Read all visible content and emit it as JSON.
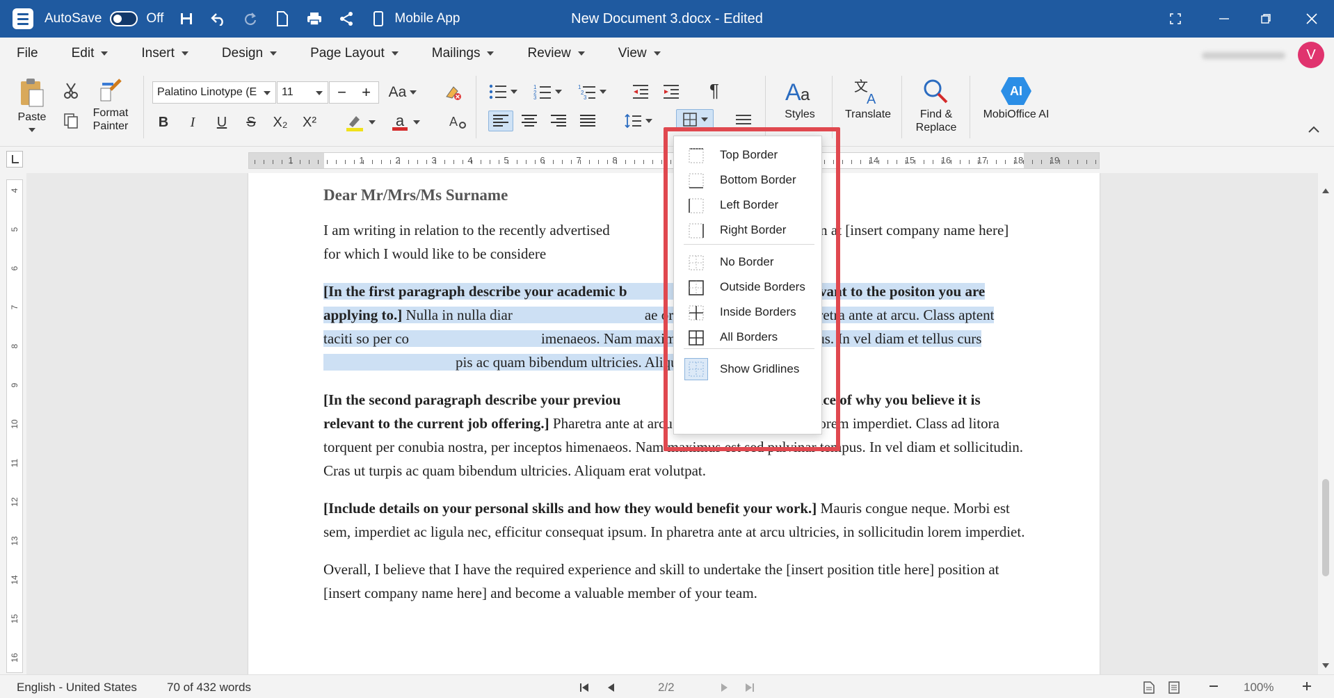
{
  "titlebar": {
    "autosave_label": "AutoSave",
    "autosave_state": "Off",
    "mobile_app_label": "Mobile App",
    "document_title": "New Document 3.docx - Edited"
  },
  "menubar": {
    "items": [
      "File",
      "Edit",
      "Insert",
      "Design",
      "Page Layout",
      "Mailings",
      "Review",
      "View"
    ],
    "avatar_initial": "V"
  },
  "ribbon": {
    "paste_label": "Paste",
    "format_painter_line1": "Format",
    "format_painter_line2": "Painter",
    "font_name": "Palatino Linotype (E",
    "font_size": "11",
    "case_label": "Aa",
    "styles_label": "Styles",
    "translate_label": "Translate",
    "find_replace_line1": "Find &",
    "find_replace_line2": "Replace",
    "mobioffice_ai_label": "MobiOffice AI",
    "ai_badge": "AI",
    "bold": "B",
    "italic": "I",
    "underline": "U",
    "strike": "S",
    "subscript": "X₂",
    "superscript": "X²",
    "font_color_glyph": "a",
    "pilcrow": "¶"
  },
  "ruler": {
    "h_numbers": [
      "1",
      "1",
      "2",
      "3",
      "4",
      "5",
      "6",
      "7",
      "8",
      "14",
      "15",
      "16",
      "17",
      "18",
      "19"
    ],
    "v_numbers": [
      "4",
      "5",
      "6",
      "7",
      "8",
      "9",
      "10",
      "11",
      "12",
      "13",
      "14",
      "15",
      "16"
    ]
  },
  "document": {
    "greeting": "Dear Mr/Mrs/Ms Surname",
    "p1_a": "I am writing in relation to the recently advertised ",
    "p1_b": "position at [insert company name here] for which I would like to be considere",
    "p2_bold": "[In the first paragraph describe your academic b",
    "p2_bold_b": "y it is relevant to the positon you are applying to.]",
    "p2_rest": " Nulla in nulla diar",
    "p2_rest_b": "ae orci auctor placerat. In pharetra ante at arcu. Class aptent taciti so per co",
    "p2_rest_c": "imenaeos. Nam maximus est sed pulvinar tempus. In vel diam et tellus curs",
    "p2_rest_d": "pis ac quam bibendum ultricies. Aliquam erat volutpat.]",
    "p3_bold": "[In the second paragraph describe your previou",
    "p3_bold_b": "vide evidence of why you believe it is relevant to the current job offering.]",
    "p3_rest": " Pharetra ante at arcu ultricies, in sollicitudin lorem imperdiet. Class ad litora torquent per conubia nostra, per inceptos himenaeos. Nam maximus est sed pulvinar tempus. In vel diam et sollicitudin. Cras ut turpis ac quam bibendum ultricies. Aliquam erat volutpat.",
    "p4_bold": "[Include details on your personal skills and how they would benefit your work.]",
    "p4_rest": " Mauris congue neque. Morbi est sem, imperdiet ac ligula nec, efficitur consequat ipsum. In pharetra ante at arcu ultricies, in sollicitudin lorem imperdiet.",
    "p5": "Overall, I believe that I have the required experience and skill to undertake the [insert position title here] position at [insert company name here] and become a valuable member of your team."
  },
  "border_menu": {
    "items": [
      {
        "label": "Top Border",
        "icon": "top-border-icon"
      },
      {
        "label": "Bottom Border",
        "icon": "bottom-border-icon"
      },
      {
        "label": "Left Border",
        "icon": "left-border-icon"
      },
      {
        "label": "Right Border",
        "icon": "right-border-icon"
      },
      {
        "label": "No Border",
        "icon": "no-border-icon"
      },
      {
        "label": "Outside Borders",
        "icon": "outside-borders-icon"
      },
      {
        "label": "Inside Borders",
        "icon": "inside-borders-icon"
      },
      {
        "label": "All Borders",
        "icon": "all-borders-icon"
      },
      {
        "label": "Show Gridlines",
        "icon": "gridlines-icon"
      }
    ],
    "highlight_color": "#e0484f"
  },
  "statusbar": {
    "language": "English - United States",
    "word_count": "70 of 432 words",
    "page": "2/2",
    "zoom": "100%"
  },
  "colors": {
    "titlebar": "#1f5aa0",
    "selection": "#cde0f4",
    "avatar": "#e0336e"
  }
}
